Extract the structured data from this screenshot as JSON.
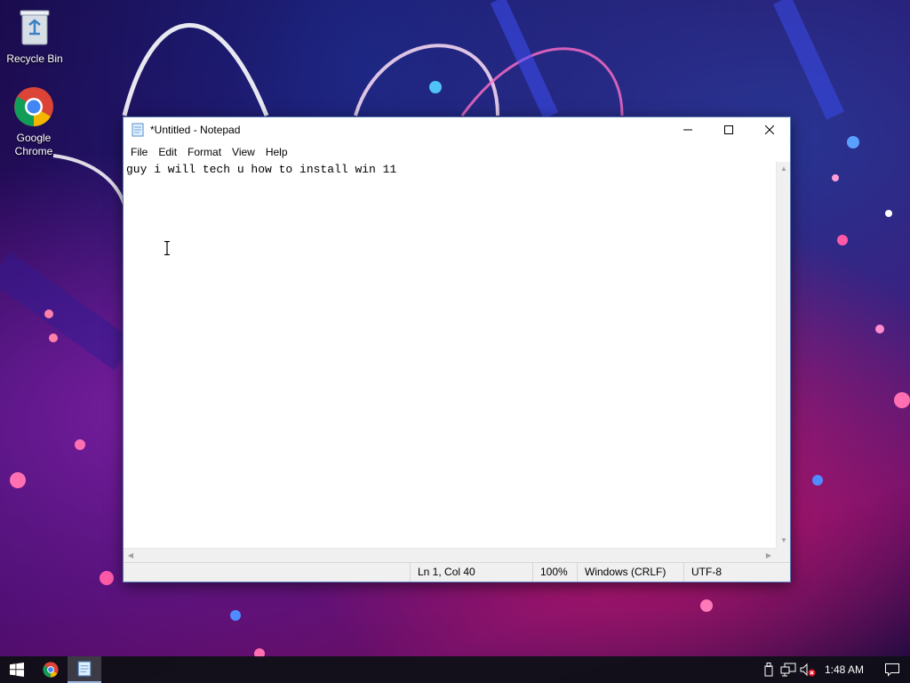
{
  "desktop": {
    "icons": [
      {
        "label": "Recycle Bin",
        "icon": "recycle-bin-icon"
      },
      {
        "label": "Google Chrome",
        "icon": "chrome-icon"
      }
    ]
  },
  "notepad": {
    "title": "*Untitled - Notepad",
    "menu": [
      "File",
      "Edit",
      "Format",
      "View",
      "Help"
    ],
    "content": "guy i will tech u how to install win 11",
    "status": {
      "position": "Ln 1, Col 40",
      "zoom": "100%",
      "line_ending": "Windows (CRLF)",
      "encoding": "UTF-8"
    }
  },
  "taskbar": {
    "apps": [
      "start-icon",
      "chrome-icon",
      "notepad-icon"
    ],
    "tray_icons": [
      "usb-icon",
      "network-icon",
      "volume-muted-icon"
    ],
    "clock": "1:48 AM"
  },
  "colors": {
    "accent": "#0078d7",
    "taskbar": "#101018"
  }
}
